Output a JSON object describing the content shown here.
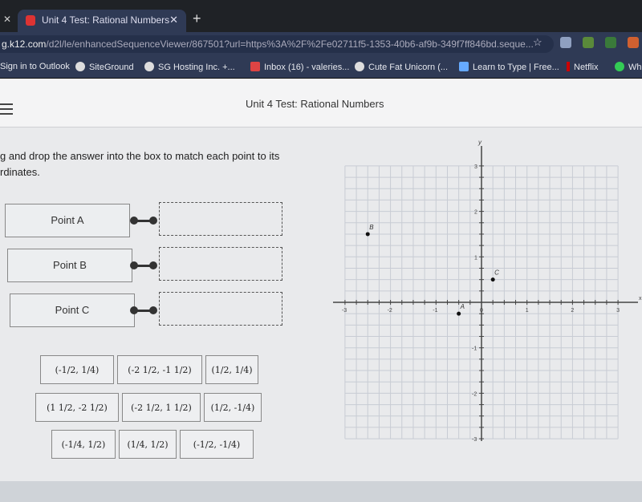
{
  "browser": {
    "tab_title": "Unit 4 Test: Rational Numbers",
    "url_host": "g.k12.com",
    "url_path": "/d2l/le/enhancedSequenceViewer/867501?url=https%3A%2F%2Fe02711f5-1353-40b6-af9b-349f7ff846bd.seque...",
    "bookmarks": [
      "Sign in to Outlook",
      "SiteGround",
      "SG Hosting Inc. +...",
      "Inbox (16) - valeries...",
      "Cute Fat Unicorn (...",
      "Learn to Type | Free...",
      "Netflix",
      "Wh"
    ]
  },
  "header": {
    "title": "Unit 4 Test: Rational Numbers"
  },
  "question": {
    "prompt": "g and drop the answer into the box to match each point to its rdinates.",
    "points": [
      "Point A",
      "Point B",
      "Point C"
    ],
    "tiles": [
      [
        "(-1/2, 1/4)",
        "(-2 1/2, -1 1/2)",
        "(1/2, 1/4)"
      ],
      [
        "(1 1/2, -2 1/2)",
        "(-2 1/2, 1 1/2)",
        "(1/2, -1/4)"
      ],
      [
        "(-1/4, 1/2)",
        "(1/4, 1/2)",
        "(-1/2, -1/4)"
      ]
    ]
  },
  "chart_data": {
    "type": "scatter",
    "xlabel": "x",
    "ylabel": "y",
    "xlim": [
      -3,
      3
    ],
    "ylim": [
      -3,
      3
    ],
    "grid": true,
    "grid_step": 0.25,
    "x_ticks": [
      "-3",
      "-2",
      "-1",
      "0",
      "1",
      "2",
      "3"
    ],
    "y_ticks": [
      "3",
      "2",
      "1",
      "-1",
      "-2",
      "-3"
    ],
    "points": [
      {
        "label": "A",
        "x": -0.5,
        "y": -0.25
      },
      {
        "label": "B",
        "x": -2.5,
        "y": 1.5
      },
      {
        "label": "C",
        "x": 0.25,
        "y": 0.5
      }
    ]
  }
}
